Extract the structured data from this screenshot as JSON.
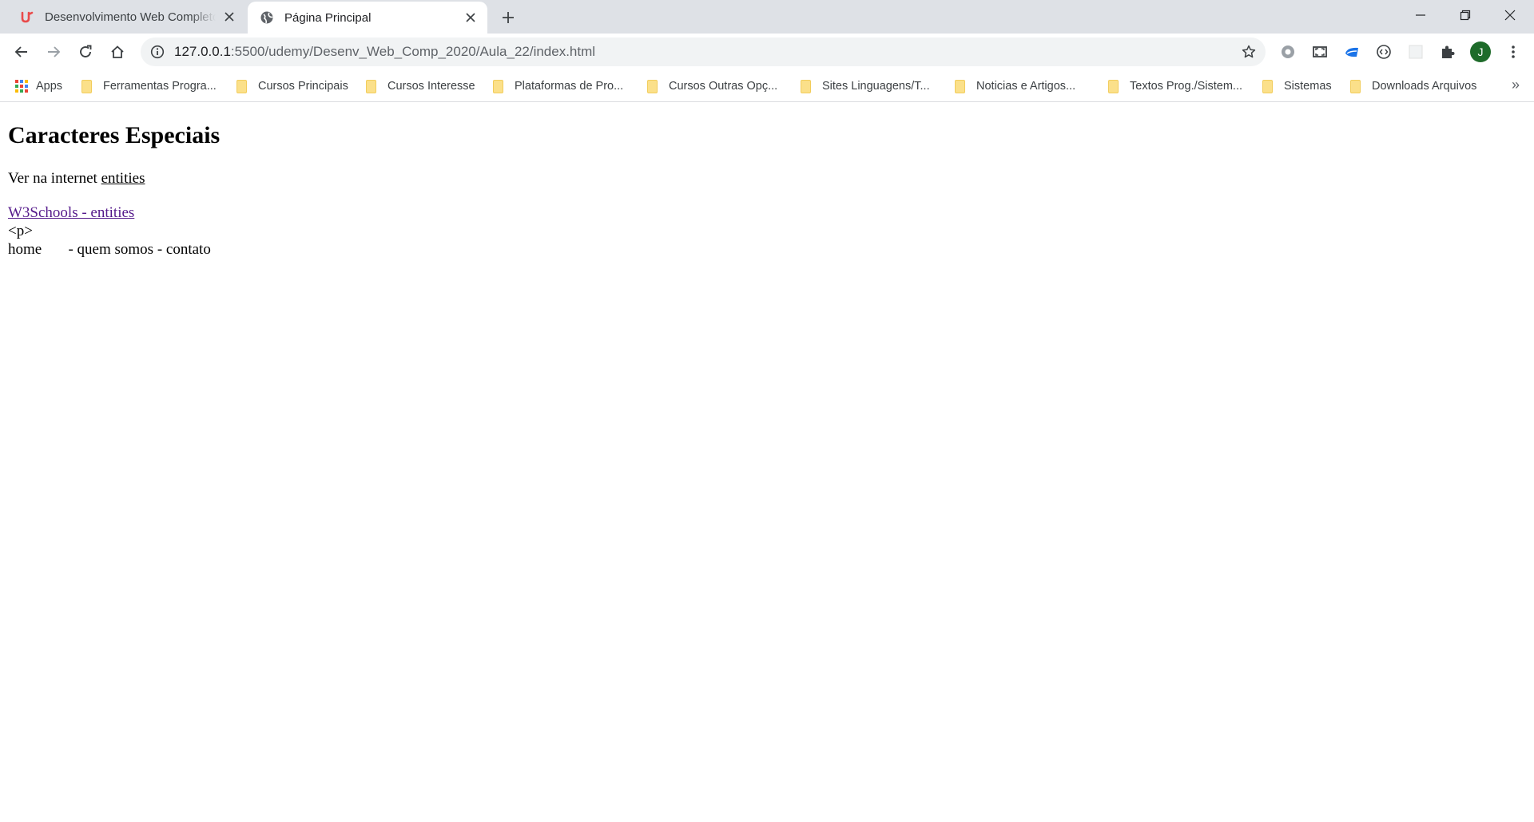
{
  "browser": {
    "tabs": [
      {
        "title": "Desenvolvimento Web Completo",
        "favicon": "udemy-icon",
        "active": false
      },
      {
        "title": "Página Principal",
        "favicon": "globe-icon",
        "active": true
      }
    ],
    "address": {
      "host": "127.0.0.1",
      "rest": ":5500/udemy/Desenv_Web_Comp_2020/Aula_22/index.html"
    },
    "profile_initial": "J",
    "bookmarks": [
      {
        "label": "Apps",
        "type": "apps"
      },
      {
        "label": "Ferramentas Progra...",
        "type": "folder"
      },
      {
        "label": "Cursos Principais",
        "type": "folder"
      },
      {
        "label": "Cursos Interesse",
        "type": "folder"
      },
      {
        "label": "Plataformas de Pro...",
        "type": "folder"
      },
      {
        "label": "Cursos Outras Opç...",
        "type": "folder"
      },
      {
        "label": "Sites Linguagens/T...",
        "type": "folder"
      },
      {
        "label": "Noticias e Artigos...",
        "type": "folder"
      },
      {
        "label": "Textos Prog./Sistem...",
        "type": "folder"
      },
      {
        "label": "Sistemas",
        "type": "folder"
      },
      {
        "label": "Downloads Arquivos",
        "type": "folder"
      }
    ],
    "more_bookmarks": "»"
  },
  "page": {
    "heading": "Caracteres Especiais",
    "intro_text": "Ver na internet",
    "intro_underlined": "entities",
    "link_text": "W3Schools - entities",
    "p_tag_text": "<p>",
    "nav_text": "home       - quem somos - contato"
  },
  "colors": {
    "tab_strip": "#dee1e6",
    "omnibox": "#f1f3f4",
    "visited_link": "#551a8b",
    "avatar": "#1e6b2a",
    "folder": "#fbe08a"
  }
}
